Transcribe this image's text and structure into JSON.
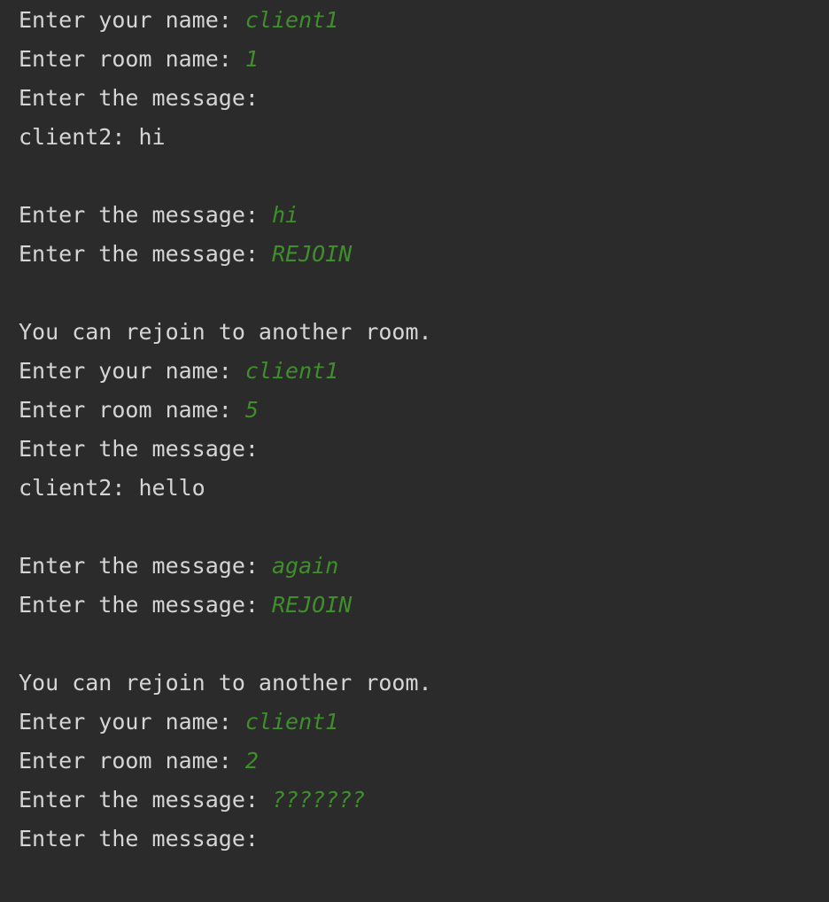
{
  "console": {
    "colors": {
      "background": "#2b2b2b",
      "output_text": "#d5d5d5",
      "user_input": "#3f8e2c"
    },
    "lines": [
      {
        "text": "Enter your name: ",
        "input": "client1"
      },
      {
        "text": "Enter room name: ",
        "input": "1"
      },
      {
        "text": "Enter the message: ",
        "input": ""
      },
      {
        "text": "client2: hi",
        "input": ""
      },
      {
        "text": "",
        "input": ""
      },
      {
        "text": "Enter the message: ",
        "input": "hi"
      },
      {
        "text": "Enter the message: ",
        "input": "REJOIN"
      },
      {
        "text": "",
        "input": ""
      },
      {
        "text": "You can rejoin to another room.",
        "input": ""
      },
      {
        "text": "Enter your name: ",
        "input": "client1"
      },
      {
        "text": "Enter room name: ",
        "input": "5"
      },
      {
        "text": "Enter the message: ",
        "input": ""
      },
      {
        "text": "client2: hello",
        "input": ""
      },
      {
        "text": "",
        "input": ""
      },
      {
        "text": "Enter the message: ",
        "input": "again"
      },
      {
        "text": "Enter the message: ",
        "input": "REJOIN"
      },
      {
        "text": "",
        "input": ""
      },
      {
        "text": "You can rejoin to another room.",
        "input": ""
      },
      {
        "text": "Enter your name: ",
        "input": "client1"
      },
      {
        "text": "Enter room name: ",
        "input": "2"
      },
      {
        "text": "Enter the message: ",
        "input": "???????"
      },
      {
        "text": "Enter the message: ",
        "input": ""
      }
    ]
  }
}
